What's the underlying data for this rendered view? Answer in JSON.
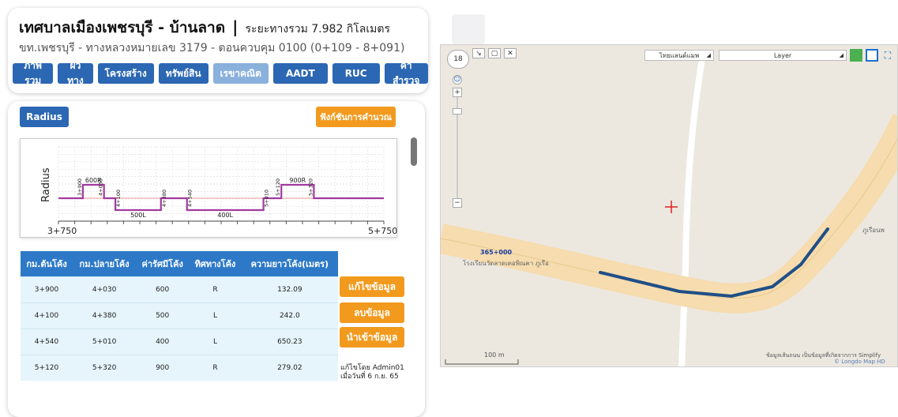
{
  "header": {
    "title": "เทศบาลเมืองเพชรบุรี - บ้านลาด",
    "separator": "|",
    "total_distance": "ระยะทางรวม 7.982 กิโลเมตร",
    "subtitle": "ขท.เพชรบุรี - ทางหลวงหมายเลข 3179 - ตอนควบคุม 0100 (0+109 - 8+091)",
    "tabs": [
      "ภาพรวม",
      "ผิวทาง",
      "โครงสร้าง",
      "ทรัพย์สิน",
      "เรขาคณิต",
      "AADT",
      "RUC",
      "ค่าสำรวจ"
    ]
  },
  "panel": {
    "radius_button": "Radius",
    "calc_button": "ฟังก์ชันการคำนวณ"
  },
  "chart_data": {
    "type": "line",
    "ylabel": "Radius",
    "x_start_label": "3+750",
    "x_end_label": "5+750",
    "x_range": [
      3750,
      5750
    ],
    "curves": [
      {
        "start": "3+900",
        "end": "4+030",
        "start_m": 3900,
        "end_m": 4030,
        "direction": "R",
        "label": "600R"
      },
      {
        "start": "4+100",
        "end": "4+380",
        "start_m": 4100,
        "end_m": 4380,
        "direction": "L",
        "label": "500L"
      },
      {
        "start": "4+540",
        "end": "5+010",
        "start_m": 4540,
        "end_m": 5010,
        "direction": "L",
        "label": "400L"
      },
      {
        "start": "5+120",
        "end": "5+320",
        "start_m": 5120,
        "end_m": 5320,
        "direction": "R",
        "label": "900R"
      }
    ],
    "station_labels": [
      "3+900",
      "4+030",
      "4+100",
      "4+380",
      "4+540",
      "5+010",
      "5+120",
      "5+320"
    ],
    "line_color": "#a23a9e",
    "baseline_color": "#e8a0a0"
  },
  "table": {
    "headers": [
      "กม.ต้นโค้ง",
      "กม.ปลายโค้ง",
      "ค่ารัศมีโค้ง",
      "ทิศทางโค้ง",
      "ความยาวโค้ง(เมตร)"
    ],
    "rows": [
      [
        "3+900",
        "4+030",
        "600",
        "R",
        "132.09"
      ],
      [
        "4+100",
        "4+380",
        "500",
        "L",
        "242.0"
      ],
      [
        "4+540",
        "5+010",
        "400",
        "L",
        "650.23"
      ],
      [
        "5+120",
        "5+320",
        "900",
        "R",
        "279.02"
      ]
    ]
  },
  "actions": {
    "edit": "แก้ไขข้อมูล",
    "delete": "ลบข้อมูล",
    "import": "นำเข้าข้อมูล",
    "edited_by": "แก้ไขโดย Admin01",
    "edited_on": "เมื่อวันที่ 6 ก.ย. 65"
  },
  "map": {
    "zoom_level": "18",
    "basemap_select": "ไทยแลนด์แมพ",
    "layer_select": "Layer",
    "poi_temple": "โรงเรียนวัดลาดเตอพิณคา ภูเรือ",
    "poi_right": "ภูเรือนพ",
    "station_marker": "365+000",
    "scale_label": "100 m",
    "attribution_1": "ข้อมูลเส้นถนน เป็นข้อมูลที่เกิดจากการ Simplify",
    "attribution_2": "© Longdo Map HD",
    "route_color": "#1f4f86",
    "road_color": "#f6dcae"
  }
}
